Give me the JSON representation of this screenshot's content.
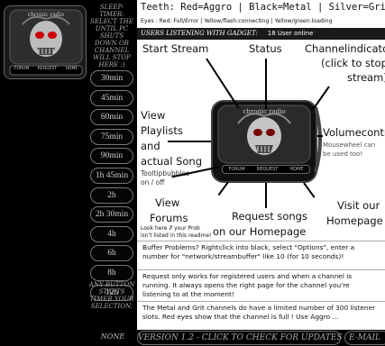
{
  "sidebar": {
    "logo_text": "chronic radio",
    "logo_buttons": [
      "FORUM",
      "REQUEST",
      "HOME"
    ],
    "sleep_title": "SLEEP-TIMER: SELECT THE UNTIL PC SHUTS DOWN OR CHANNEL WILL STOP HERE :)",
    "timers": [
      "30min",
      "45min",
      "60min",
      "75min",
      "90min",
      "1h 45min",
      "2h",
      "2h 30min",
      "4h",
      "6h",
      "8h",
      "12h"
    ],
    "sleep_foot": "ANY BUTTON STARTS TIMER YOUR SELECTION:",
    "none_label": "NONE"
  },
  "header": {
    "teeth_prefix": "Teeth:",
    "teeth_legend": "Red=Aggro | Black=Metal | Silver=Grit",
    "eyes_legend": "Eyes : Red: Full/Error | Yellow/flash:connecting | Yellow/green:loading",
    "listeners_label": "USERS LISTENING WITH GADGET:",
    "listeners_value": "18 User online"
  },
  "help": {
    "start_stream": "Start Stream",
    "status": "Status",
    "channel_line1": "Channelindicator",
    "channel_line2": "(click to stop",
    "channel_line3": "stream)",
    "playlists_1": "View",
    "playlists_2": "Playlists",
    "playlists_3": "and",
    "playlists_4": "actual Song",
    "tooltip_1": "Tooltipbubbles",
    "tooltip_2": "on / off",
    "volume": "Volumecontrol",
    "mouse_1": "Mousewheel can",
    "mouse_2": "be used too!",
    "forums_1": "View",
    "forums_2": "Forums",
    "prob_1": "Look here if your Prob",
    "prob_2": "isn't listed in this readme!",
    "requests_1": "Request songs",
    "requests_2": "on our Homepage",
    "visit_1": "Visit our",
    "visit_2": "Homepage"
  },
  "info": [
    "Buffer Problems? Rightclick into black, select \"Options\", enter a number for \"network/streambuffer\" like 10 (for 10 seconds)!",
    "Request only works for registered users and when a channel is running. It always opens the right page for the channel you're listening to at the moment!",
    "The Metal and Grit channels do have a limited number of 300 listener slots. Red eyes show that the channel is full ! Use Aggro ..."
  ],
  "footer": {
    "version": "VERSION 1.2 - CLICK TO CHECK FOR UPDATES",
    "email": "E-MAIL"
  }
}
